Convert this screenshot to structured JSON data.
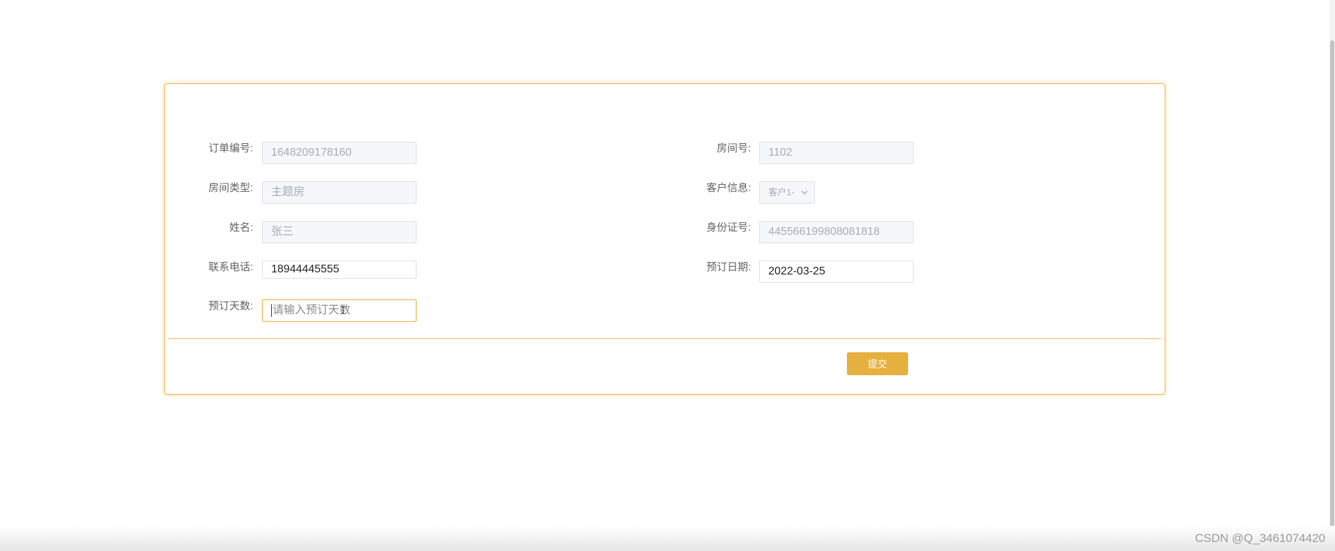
{
  "form": {
    "left_fields": [
      {
        "label": "订单编号:",
        "value": "1648209178160",
        "state": "disabled"
      },
      {
        "label": "房间类型:",
        "value": "主题房",
        "state": "disabled"
      },
      {
        "label": "姓名:",
        "value": "张三",
        "state": "disabled"
      },
      {
        "label": "联系电话:",
        "value": "18944445555",
        "state": "editable"
      },
      {
        "label": "预订天数:",
        "placeholder": "请输入预订天数",
        "state": "focused"
      }
    ],
    "right_fields": [
      {
        "label": "房间号:",
        "value": "1102",
        "state": "disabled"
      },
      {
        "label": "客户信息:",
        "value": "客户1-",
        "state": "disabled-select"
      },
      {
        "label": "身份证号:",
        "value": "445566199808081818",
        "state": "disabled"
      },
      {
        "label": "预订日期:",
        "value": "2022-03-25",
        "state": "editable"
      }
    ],
    "submit_label": "提交"
  },
  "watermark": "CSDN @Q_3461074420",
  "colors": {
    "accent": "#e6b03e",
    "border_accent": "#e8b64a",
    "disabled_bg": "#f5f7fa",
    "label_text": "#606266"
  },
  "icons": {
    "select_arrow": "chevron-down-icon",
    "mouse_cursor": "text-cursor-icon"
  }
}
